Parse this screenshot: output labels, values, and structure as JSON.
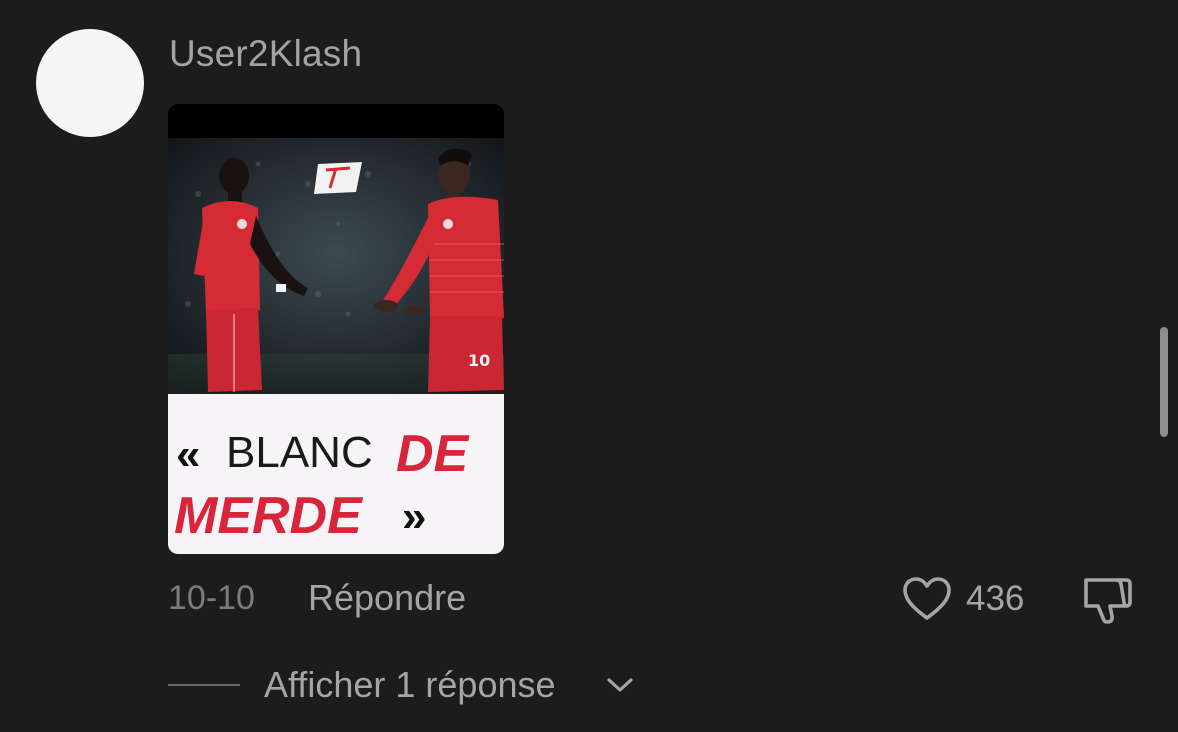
{
  "comment": {
    "username": "User2Klash",
    "image_caption": {
      "quote_open": "«",
      "word_blanc": "BLANC",
      "word_de": "DE",
      "word_merde": "MERDE",
      "quote_close": "»"
    },
    "date": "10-10",
    "reply_label": "Répondre",
    "like_count": "436",
    "show_replies_label": "Afficher 1 réponse"
  },
  "colors": {
    "background": "#1c1c1c",
    "muted_text": "#a5a5a5",
    "caption_red": "#d8253a",
    "jersey_red": "#d42b35"
  },
  "icons": {
    "like": "heart-icon",
    "dislike": "thumbs-down-icon",
    "expand": "chevron-down-icon"
  }
}
